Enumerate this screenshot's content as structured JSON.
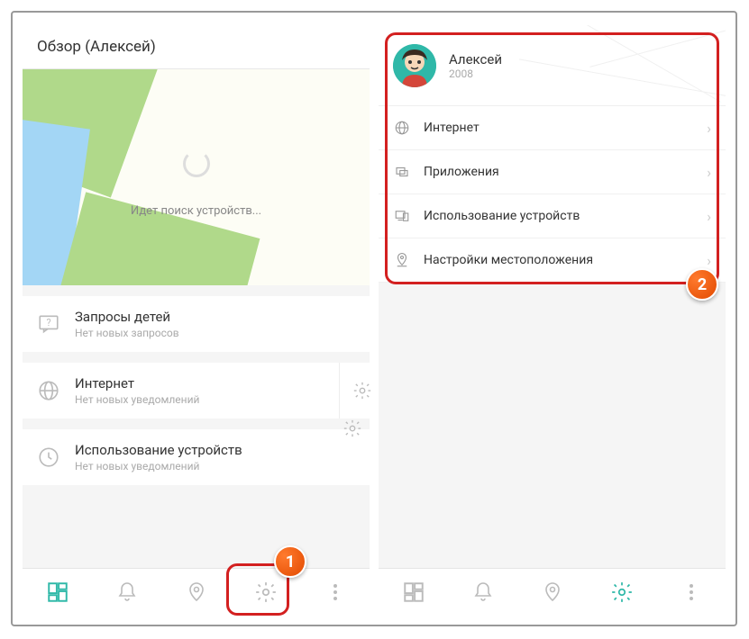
{
  "left": {
    "headerTitle": "Обзор (Алексей)",
    "mapSearching": "Идет поиск устройств...",
    "cards": {
      "requests": {
        "title": "Запросы детей",
        "sub": "Нет новых запросов"
      },
      "internet": {
        "title": "Интернет",
        "sub": "Нет новых уведомлений"
      },
      "devices": {
        "title": "Использование устройств",
        "sub": "Нет новых уведомлений"
      }
    }
  },
  "right": {
    "profile": {
      "name": "Алексей",
      "year": "2008"
    },
    "items": [
      {
        "label": "Интернет"
      },
      {
        "label": "Приложения"
      },
      {
        "label": "Использование устройств"
      },
      {
        "label": "Настройки местоположения"
      }
    ]
  },
  "badges": {
    "one": "1",
    "two": "2"
  }
}
